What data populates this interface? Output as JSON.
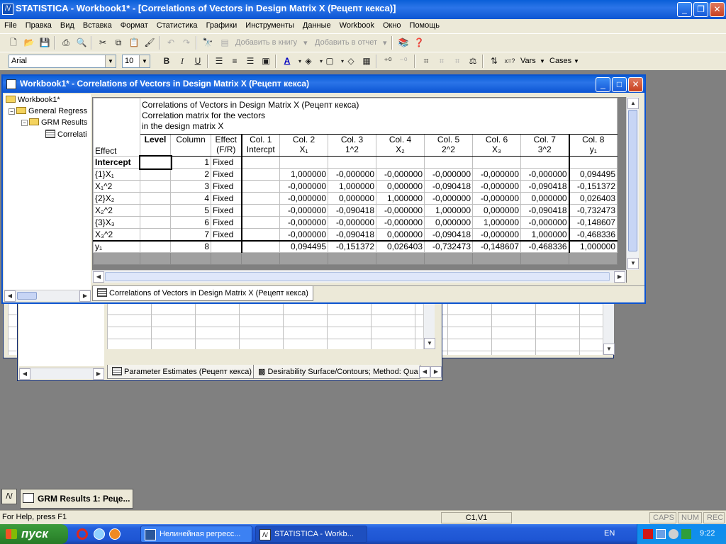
{
  "app": {
    "title": "STATISTICA - Workbook1* - [Correlations of Vectors in Design Matrix X (Рецепт кекса)]",
    "icon_label": "/\\/",
    "minimize": "_",
    "restore": "❐",
    "close": "✕"
  },
  "menu": [
    "File",
    "Правка",
    "Вид",
    "Вставка",
    "Формат",
    "Статистика",
    "Графики",
    "Инструменты",
    "Данные",
    "Workbook",
    "Окно",
    "Помощь"
  ],
  "toolbar": {
    "add_to_workbook": "Добавить в книгу",
    "add_to_report": "Добавить в отчет",
    "font_name": "Arial",
    "font_size": "10",
    "bold": "B",
    "italic": "I",
    "underline": "U",
    "vars": "Vars",
    "cases": "Cases"
  },
  "workbook_window": {
    "title": "Workbook1* - Correlations of Vectors in Design Matrix X (Рецепт кекса)",
    "minimize": "_",
    "maximize": "□",
    "close": "✕"
  },
  "tree": {
    "root": "Workbook1*",
    "analysis": "General Regress",
    "results": "GRM Results",
    "sheet": "Correlati"
  },
  "spreadsheet": {
    "header_lines": [
      "Correlations of Vectors in Design Matrix X (Рецепт кекса)",
      "Correlation matrix for the vectors",
      "in the design matrix X"
    ],
    "effect_header": "Effect",
    "columns": [
      {
        "top": "Level",
        "bottom": ""
      },
      {
        "top": "Column",
        "bottom": ""
      },
      {
        "top": "Effect",
        "bottom": "(F/R)"
      },
      {
        "top": "Col. 1",
        "bottom": "Intercpt"
      },
      {
        "top": "Col. 2",
        "bottom": "X₁"
      },
      {
        "top": "Col. 3",
        "bottom": "1^2"
      },
      {
        "top": "Col. 4",
        "bottom": "X₂"
      },
      {
        "top": "Col. 5",
        "bottom": "2^2"
      },
      {
        "top": "Col. 6",
        "bottom": "X₃"
      },
      {
        "top": "Col. 7",
        "bottom": "3^2"
      },
      {
        "top": "Col. 8",
        "bottom": "y₁"
      }
    ],
    "rows": [
      {
        "effect": "Intercept",
        "level": "",
        "column": "1",
        "fr": "Fixed",
        "vals": [
          "",
          "",
          "",
          "",
          "",
          "",
          "",
          ""
        ]
      },
      {
        "effect": "{1}X₁",
        "level": "",
        "column": "2",
        "fr": "Fixed",
        "vals": [
          "",
          "1,000000",
          "-0,000000",
          "-0,000000",
          "-0,000000",
          "-0,000000",
          "-0,000000",
          "0,094495"
        ]
      },
      {
        "effect": "X₁^2",
        "level": "",
        "column": "3",
        "fr": "Fixed",
        "vals": [
          "",
          "-0,000000",
          "1,000000",
          "0,000000",
          "-0,090418",
          "-0,000000",
          "-0,090418",
          "-0,151372"
        ]
      },
      {
        "effect": "{2}X₂",
        "level": "",
        "column": "4",
        "fr": "Fixed",
        "vals": [
          "",
          "-0,000000",
          "0,000000",
          "1,000000",
          "-0,000000",
          "-0,000000",
          "0,000000",
          "0,026403"
        ]
      },
      {
        "effect": "X₂^2",
        "level": "",
        "column": "5",
        "fr": "Fixed",
        "vals": [
          "",
          "-0,000000",
          "-0,090418",
          "-0,000000",
          "1,000000",
          "0,000000",
          "-0,090418",
          "-0,732473"
        ]
      },
      {
        "effect": "{3}X₃",
        "level": "",
        "column": "6",
        "fr": "Fixed",
        "vals": [
          "",
          "-0,000000",
          "-0,000000",
          "-0,000000",
          "0,000000",
          "1,000000",
          "-0,000000",
          "-0,148607"
        ]
      },
      {
        "effect": "X₃^2",
        "level": "",
        "column": "7",
        "fr": "Fixed",
        "vals": [
          "",
          "-0,000000",
          "-0,090418",
          "0,000000",
          "-0,090418",
          "-0,000000",
          "1,000000",
          "-0,468336"
        ]
      },
      {
        "effect": "y₁",
        "level": "",
        "column": "8",
        "fr": "",
        "vals": [
          "",
          "0,094495",
          "-0,151372",
          "0,026403",
          "-0,732473",
          "-0,148607",
          "-0,468336",
          "1,000000"
        ]
      }
    ]
  },
  "tabs": {
    "front": "Correlations of Vectors in Design Matrix X (Рецепт кекса)",
    "back1": "Parameter Estimates (Рецепт кекса)",
    "back2": "Desirability Surface/Contours; Method: Qua"
  },
  "minimized": {
    "label": "GRM Results 1: Реце..."
  },
  "status": {
    "help": "For Help, press F1",
    "cell": "C1,V1",
    "caps": "CAPS",
    "num": "NUM",
    "rec": "REC"
  },
  "taskbar": {
    "start": "пуск",
    "item1": "Нелинейная регресс...",
    "item2": "STATISTICA - Workb...",
    "lang": "EN",
    "clock": "9:22"
  }
}
